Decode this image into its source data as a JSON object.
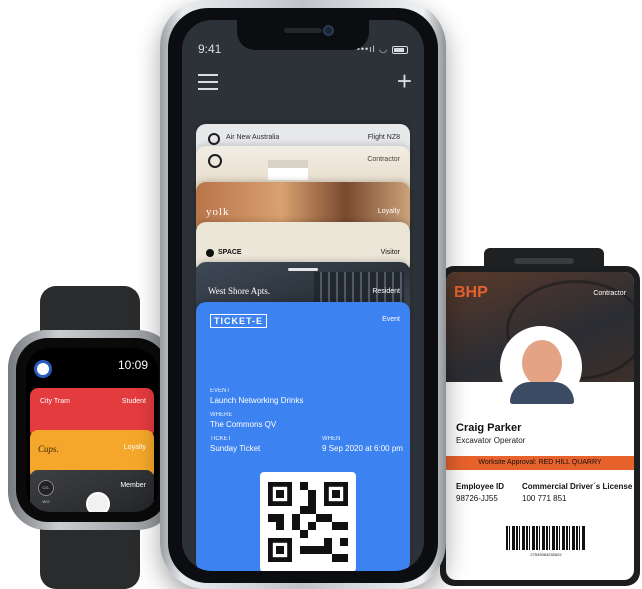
{
  "phone": {
    "status_time": "9:41",
    "status_icons": "•••ıl ◡",
    "cards": [
      {
        "title": "Air New Australia",
        "tag": "Flight NZ8"
      },
      {
        "title": "",
        "tag": "Contractor"
      },
      {
        "title": "yolk",
        "tag": "Loyalty"
      },
      {
        "title": "SPACE",
        "tag": "Visitor"
      },
      {
        "title": "West Shore Apts.",
        "tag": "Resident"
      }
    ],
    "event_card": {
      "logo": "TICKET-E",
      "tag": "Event",
      "event_label": "EVENT",
      "event_value": "Launch Networking Drinks",
      "where_label": "WHERE",
      "where_value": "The Commons QV",
      "ticket_label": "TICKET",
      "ticket_value": "Sunday Ticket",
      "when_label": "WHEN",
      "when_value": "9 Sep 2020 at 6:00 pm"
    }
  },
  "watch": {
    "time": "10:09",
    "cards": [
      {
        "title": "City Tram",
        "tag": "Student"
      },
      {
        "title": "Cups.",
        "tag": "Loyalty"
      },
      {
        "title": "",
        "tag": "Member",
        "mini_logo": "CO-WO"
      }
    ]
  },
  "badge": {
    "brand": "BHP",
    "tag": "Contractor",
    "name": "Craig Parker",
    "role": "Excavator Operator",
    "approval": "Worksite Approval: RED HILL QUARRY",
    "employee_id_label": "Employee ID",
    "employee_id": "98726-JJ55",
    "license_label": "Commercial Driver´s License",
    "license": "100 771 851",
    "barcode_number": "27539363292622"
  },
  "colors": {
    "event_blue": "#3c82f0",
    "bhp_orange": "#e8622c",
    "watch_red": "#e43b3f",
    "watch_yellow": "#f4a72a"
  }
}
